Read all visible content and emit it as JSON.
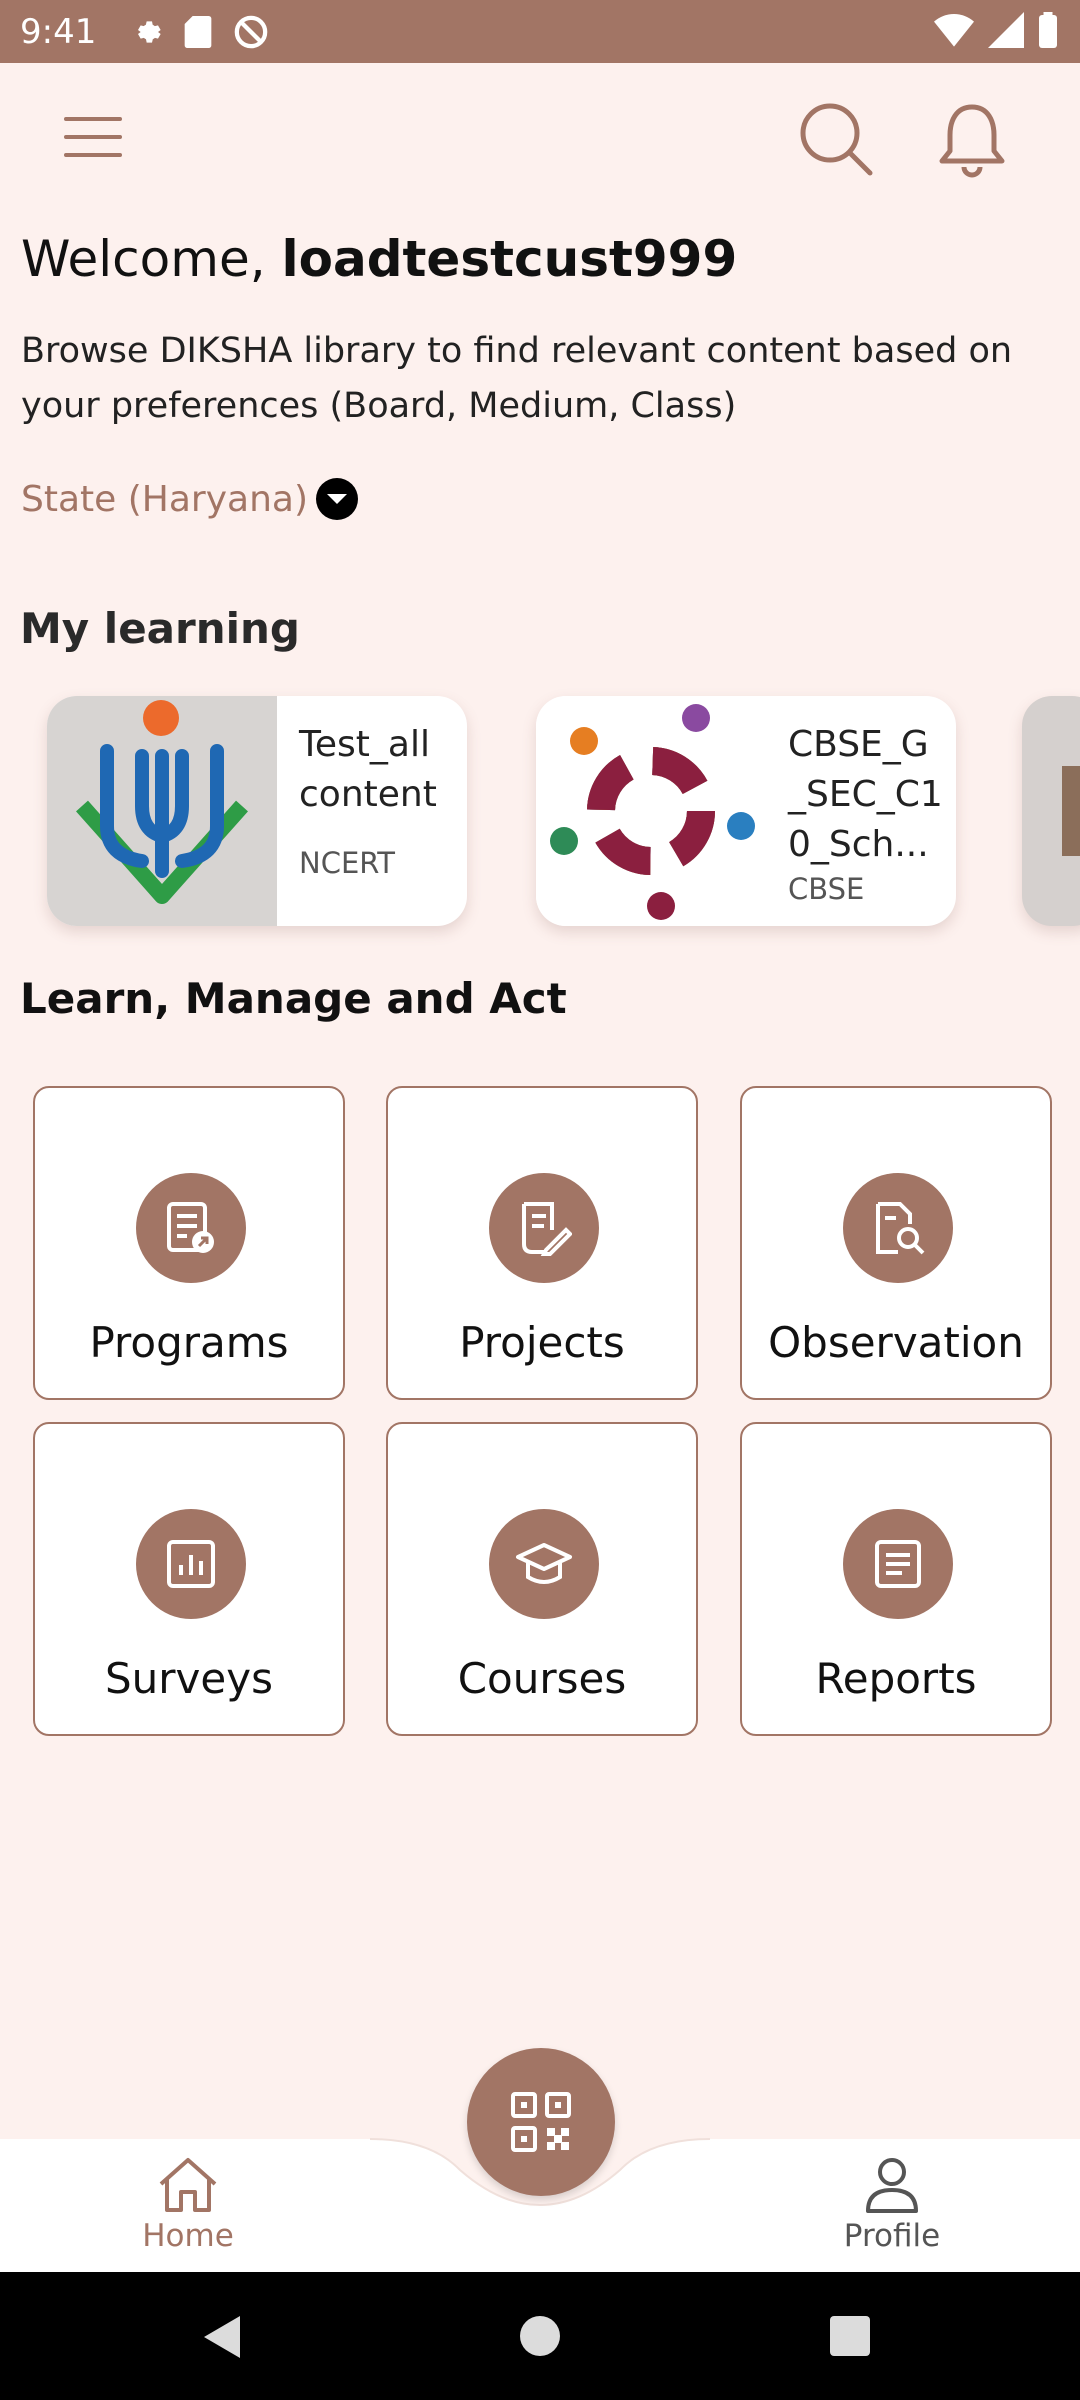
{
  "status_bar": {
    "time": "9:41",
    "left_icons": [
      "settings-icon",
      "sd-card-icon",
      "do-not-disturb-icon"
    ],
    "right_icons": [
      "wifi-icon",
      "signal-icon",
      "battery-icon"
    ]
  },
  "header": {
    "welcome_prefix": "Welcome, ",
    "username": "loadtestcust999",
    "description": "Browse DIKSHA library to find relevant content based on your preferences (Board, Medium, Class)",
    "board_selector": "State (Haryana)"
  },
  "my_learning": {
    "title": "My learning",
    "cards": [
      {
        "title": "Test_all content",
        "subtitle": "NCERT"
      },
      {
        "title": "CBSE_G _SEC_C1 0_Sch...",
        "subtitle": "CBSE"
      }
    ]
  },
  "learn_manage_act": {
    "title": "Learn, Manage and Act",
    "tiles": [
      {
        "label": "Programs",
        "icon": "programs-icon"
      },
      {
        "label": "Projects",
        "icon": "projects-icon"
      },
      {
        "label": "Observation",
        "icon": "observation-icon"
      },
      {
        "label": "Surveys",
        "icon": "surveys-icon"
      },
      {
        "label": "Courses",
        "icon": "courses-icon"
      },
      {
        "label": "Reports",
        "icon": "reports-icon"
      }
    ]
  },
  "bottom_nav": {
    "home_label": "Home",
    "profile_label": "Profile"
  },
  "colors": {
    "accent": "#a27565",
    "background": "#fdf1ee"
  }
}
